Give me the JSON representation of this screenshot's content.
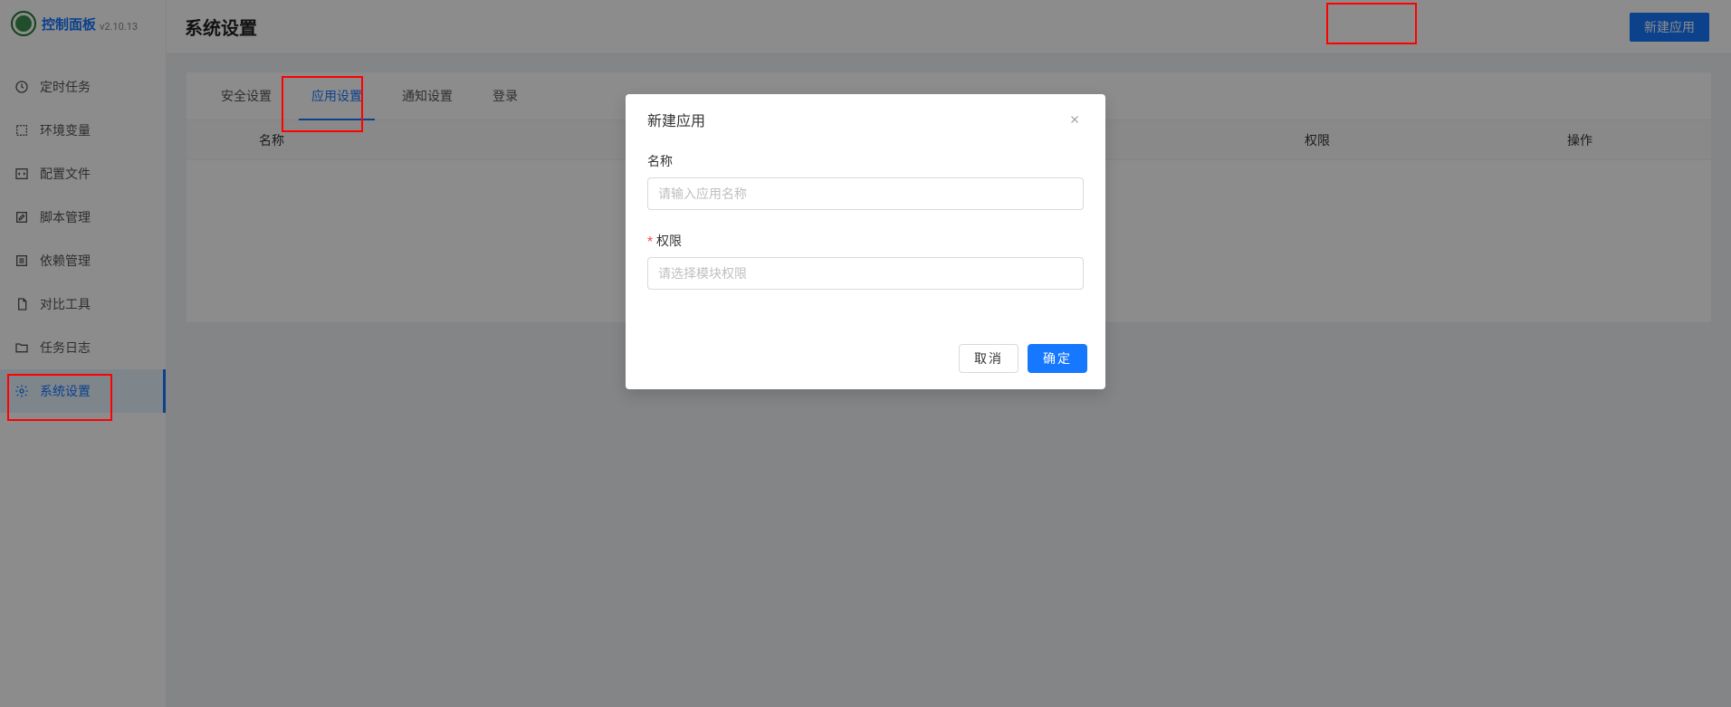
{
  "app": {
    "title": "控制面板",
    "version": "v2.10.13"
  },
  "sidebar": {
    "items": [
      {
        "icon": "clock-icon",
        "label": "定时任务"
      },
      {
        "icon": "brackets-icon",
        "label": "环境变量"
      },
      {
        "icon": "code-icon",
        "label": "配置文件"
      },
      {
        "icon": "edit-icon",
        "label": "脚本管理"
      },
      {
        "icon": "list-icon",
        "label": "依赖管理"
      },
      {
        "icon": "file-icon",
        "label": "对比工具"
      },
      {
        "icon": "folder-icon",
        "label": "任务日志"
      },
      {
        "icon": "settings-icon",
        "label": "系统设置"
      }
    ]
  },
  "page": {
    "title": "系统设置",
    "new_app_button": "新建应用"
  },
  "tabs": [
    {
      "label": "安全设置"
    },
    {
      "label": "应用设置"
    },
    {
      "label": "通知设置"
    },
    {
      "label": "登录"
    }
  ],
  "table": {
    "columns": {
      "name": "名称",
      "perm": "权限",
      "op": "操作"
    }
  },
  "modal": {
    "title": "新建应用",
    "fields": {
      "name_label": "名称",
      "name_placeholder": "请输入应用名称",
      "perm_label": "权限",
      "perm_placeholder": "请选择模块权限"
    },
    "cancel": "取消",
    "confirm": "确定"
  }
}
